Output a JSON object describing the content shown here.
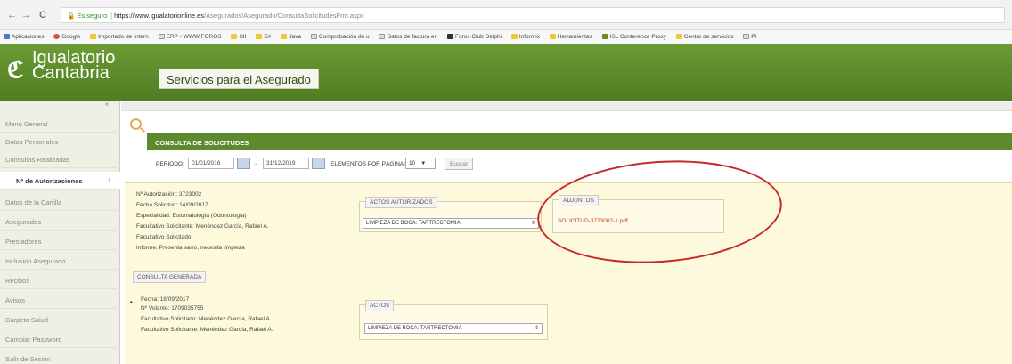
{
  "browser": {
    "back": "←",
    "forward": "→",
    "reload": "C",
    "security_label": "Es seguro",
    "url_host": "https://www.igualatorionline.es",
    "url_path": "/Asegurados/Asegurado/ConsultaSolicitudesFrm.aspx",
    "bookmarks": [
      {
        "label": "Aplicaciones",
        "icon": "apps-icon"
      },
      {
        "label": "Google",
        "icon": "google-icon"
      },
      {
        "label": "Importado de Intern",
        "icon": "folder-icon"
      },
      {
        "label": "ERP - WWW.FOROS",
        "icon": "page-icon"
      },
      {
        "label": "SII",
        "icon": "folder-icon"
      },
      {
        "label": "C#",
        "icon": "folder-icon"
      },
      {
        "label": "Java",
        "icon": "folder-icon"
      },
      {
        "label": "Comprobación de u",
        "icon": "page-icon"
      },
      {
        "label": "Datos de factura en",
        "icon": "page-icon"
      },
      {
        "label": "Foros Club Delphi",
        "icon": "dark-icon"
      },
      {
        "label": "Informix",
        "icon": "folder-icon"
      },
      {
        "label": "Herramientas",
        "icon": "folder-icon"
      },
      {
        "label": "ISL Conference Proxy",
        "icon": "green-icon"
      },
      {
        "label": "Centro de servicios",
        "icon": "folder-icon"
      },
      {
        "label": "Pl",
        "icon": "page-icon"
      }
    ]
  },
  "header": {
    "logo_line1": "Igualatorio",
    "logo_line2": "Cantabria",
    "service_title": "Servicios para el Asegurado",
    "brand_color": "#5e8a2e"
  },
  "sidebar": {
    "collapse_symbol": "«",
    "items": [
      {
        "label": "Menu General"
      },
      {
        "label": "Datos Personales"
      },
      {
        "label": "Consultas Realizadas"
      },
      {
        "label": "Nº de Autorizaciones"
      },
      {
        "label": "Datos de la Cartilla"
      },
      {
        "label": "Asegurados"
      },
      {
        "label": "Prestadores"
      },
      {
        "label": "Inclusion Asegurado"
      },
      {
        "label": "Recibos"
      },
      {
        "label": "Avisos"
      },
      {
        "label": "Carpeta Salud"
      },
      {
        "label": "Cambiar Password"
      },
      {
        "label": "Salir de Sesión"
      }
    ],
    "active_index": 3
  },
  "main": {
    "section_title": "CONSULTA DE SOLICITUDES",
    "filter": {
      "period_label": "PERIODO:",
      "date_from": "01/01/2016",
      "separator": "-",
      "date_to": "31/12/2019",
      "page_size_label": "ELEMENTOS POR PÁGINA:",
      "page_size": "10",
      "search_button": "Buscar"
    },
    "request": {
      "rows": [
        {
          "label": "Nº Autorización:",
          "value": "3723002"
        },
        {
          "label": "Fecha Solicitud:",
          "value": "14/09/2017"
        },
        {
          "label": "Especialidad:",
          "value": "Estomatología (Odontología)"
        },
        {
          "label": "Facultativo Solicitante:",
          "value": "Menéndez García, Rafael A."
        },
        {
          "label": "Facultativo Solicitado:",
          "value": ""
        },
        {
          "label": "Informe:",
          "value": "Presenta sarro, necesita limpieza"
        }
      ],
      "authorized_acts_legend": "ACTOS AUTORIZADOS",
      "authorized_act": "LIMPIEZA DE BOCA: TARTRECTOMIA",
      "attachments_legend": "ADJUNTOS",
      "attachment_file": "SOLICITUD-3723002-1.pdf"
    },
    "generated": {
      "legend": "CONSULTA GENERADA",
      "rows": [
        {
          "label": "Fecha:",
          "value": "18/09/2017"
        },
        {
          "label": "Nº Volante:",
          "value": "1709035755"
        },
        {
          "label": "Facultativo Solicitado:",
          "value": "Menéndez García, Rafael A."
        },
        {
          "label": "Facultativo Solicitante:",
          "value": "Menéndez García, Rafael A."
        }
      ],
      "acts_legend": "ACTOS",
      "act": "LIMPIEZA DE BOCA: TARTRECTOMIA"
    }
  }
}
